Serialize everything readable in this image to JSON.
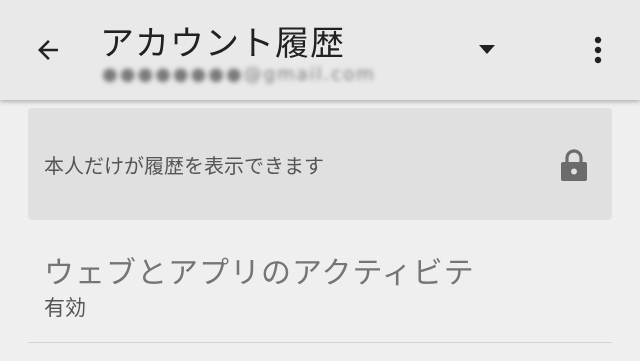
{
  "appbar": {
    "title": "アカウント履歴",
    "account": "●●●●●●●●@gmail.com",
    "back_icon": "arrow-back-icon",
    "dropdown_icon": "arrow-drop-down-icon",
    "more_icon": "more-vert-icon"
  },
  "privacy_card": {
    "text": "本人だけが履歴を表示できます",
    "icon": "lock-icon"
  },
  "activity": {
    "title": "ウェブとアプリのアクティビテ",
    "status": "有効"
  }
}
